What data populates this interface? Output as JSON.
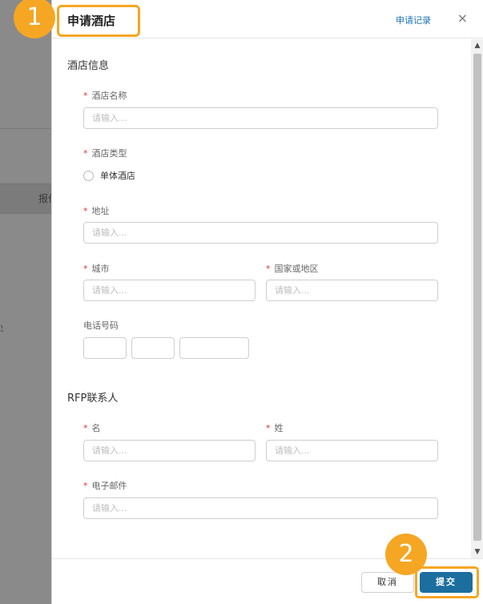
{
  "background": {
    "band_text": "报价",
    "side_text": "业"
  },
  "modal": {
    "title": "申请酒店",
    "header_link": "申请记录",
    "close_icon": "×"
  },
  "sections": {
    "hotel_info": "酒店信息",
    "rfp_contact": "RFP联系人"
  },
  "fields": {
    "hotel_name": {
      "label": "酒店名称",
      "required": "*",
      "placeholder": "请输入...",
      "value": ""
    },
    "hotel_type": {
      "label": "酒店类型",
      "required": "*",
      "option": "单体酒店",
      "selected": false
    },
    "address": {
      "label": "地址",
      "required": "*",
      "placeholder": "请输入...",
      "value": ""
    },
    "city": {
      "label": "城市",
      "required": "*",
      "placeholder": "请输入...",
      "value": ""
    },
    "country": {
      "label": "国家或地区",
      "required": "*",
      "placeholder": "请输入...",
      "value": ""
    },
    "phone": {
      "label": "电话号码",
      "parts": [
        "",
        "",
        ""
      ]
    },
    "first_name": {
      "label": "名",
      "required": "*",
      "placeholder": "请输入...",
      "value": ""
    },
    "last_name": {
      "label": "姓",
      "required": "*",
      "placeholder": "请输入...",
      "value": ""
    },
    "email": {
      "label": "电子邮件",
      "required": "*",
      "placeholder": "请输入...",
      "value": ""
    }
  },
  "footer": {
    "cancel_label": "取消",
    "submit_label": "提交"
  },
  "badges": {
    "step1": "1",
    "step2": "2"
  },
  "scrollbar": {
    "up_icon": "▲",
    "down_icon": "▼"
  },
  "colors": {
    "primary": "#1b6e9e",
    "link": "#1a73b5",
    "required": "#d9352e",
    "highlight": "#f5a623"
  }
}
